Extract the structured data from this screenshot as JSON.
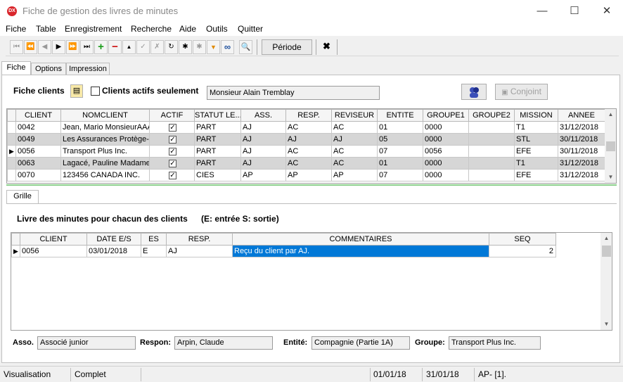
{
  "window": {
    "app_icon": "DX",
    "title": "Fiche de gestion des livres de minutes",
    "minimize": "—",
    "maximize": "☐",
    "close": "✕"
  },
  "menu": [
    "Fiche",
    "Table",
    "Enregistrement",
    "Recherche",
    "Aide",
    "Outils",
    "Quitter"
  ],
  "toolbar": {
    "buttons": [
      {
        "icon": "first-record-icon",
        "glyph": "⏮"
      },
      {
        "icon": "prev-page-icon",
        "glyph": "⏪"
      },
      {
        "icon": "prev-record-icon",
        "glyph": "◀"
      },
      {
        "icon": "next-record-icon",
        "glyph": "▶"
      },
      {
        "icon": "next-page-icon",
        "glyph": "⏩"
      },
      {
        "icon": "last-record-icon",
        "glyph": "⏭"
      },
      {
        "icon": "add-icon",
        "glyph": "+"
      },
      {
        "icon": "delete-icon",
        "glyph": "−"
      },
      {
        "icon": "edit-icon",
        "glyph": "▲"
      },
      {
        "icon": "confirm-icon",
        "glyph": "✓"
      },
      {
        "icon": "cancel-icon",
        "glyph": "✗"
      },
      {
        "icon": "refresh-icon",
        "glyph": "↻"
      },
      {
        "icon": "asterisk-icon",
        "glyph": "✱"
      },
      {
        "icon": "asterisk-grey-icon",
        "glyph": "✱"
      },
      {
        "icon": "filter-icon",
        "glyph": "▼"
      },
      {
        "icon": "binoculars-icon",
        "glyph": "∞"
      },
      {
        "icon": "search-icon",
        "glyph": "🔍"
      }
    ],
    "periode_label": "Période",
    "exit_glyph": "✖"
  },
  "tabs_top": [
    "Fiche",
    "Options",
    "Impression"
  ],
  "fiche": {
    "label": "Fiche clients",
    "actifs_label": "Clients actifs seulement",
    "actifs_checked": false,
    "client_display": "Monsieur Alain Tremblay",
    "conjoint_label": "Conjoint",
    "users_icon": "users-icon",
    "document_icon": "document-icon"
  },
  "clients_table": {
    "columns": [
      "CLIENT",
      "NOMCLIENT",
      "ACTIF",
      "STATUT LE...",
      "ASS.",
      "RESP.",
      "REVISEUR",
      "ENTITE",
      "GROUPE1",
      "GROUPE2",
      "MISSION",
      "ANNEE"
    ],
    "rows": [
      {
        "client": "0042",
        "nom": "Jean, Mario MonsieurAAA",
        "actif": true,
        "statut": "PART",
        "ass": "AJ",
        "resp": "AC",
        "reviseur": "AC",
        "entite": "01",
        "groupe1": "0000",
        "groupe2": "",
        "mission": "T1",
        "annee": "31/12/2018"
      },
      {
        "client": "0049",
        "nom": "Les Assurances Protège-T",
        "actif": true,
        "statut": "PART",
        "ass": "AJ",
        "resp": "AJ",
        "reviseur": "AJ",
        "entite": "05",
        "groupe1": "0000",
        "groupe2": "",
        "mission": "STL",
        "annee": "30/11/2018"
      },
      {
        "client": "0056",
        "nom": "Transport Plus Inc.",
        "actif": true,
        "statut": "PART",
        "ass": "AJ",
        "resp": "AC",
        "reviseur": "AC",
        "entite": "07",
        "groupe1": "0056",
        "groupe2": "",
        "mission": "EFE",
        "annee": "30/11/2018"
      },
      {
        "client": "0063",
        "nom": "Lagacé, Pauline Madame",
        "actif": true,
        "statut": "PART",
        "ass": "AJ",
        "resp": "AC",
        "reviseur": "AC",
        "entite": "01",
        "groupe1": "0000",
        "groupe2": "",
        "mission": "T1",
        "annee": "31/12/2018"
      },
      {
        "client": "0070",
        "nom": "123456 CANADA INC.",
        "actif": true,
        "statut": "CIES",
        "ass": "AP",
        "resp": "AP",
        "reviseur": "AP",
        "entite": "07",
        "groupe1": "0000",
        "groupe2": "",
        "mission": "EFE",
        "annee": "31/12/2018"
      }
    ],
    "current_row": 2
  },
  "grille": {
    "tab_label": "Grille",
    "heading": "Livre des minutes pour chacun des clients",
    "legend": "(E: entrée  S: sortie)",
    "columns": [
      "CLIENT",
      "DATE E/S",
      "ES",
      "RESP.",
      "COMMENTAIRES",
      "SEQ"
    ],
    "rows": [
      {
        "client": "0056",
        "date": "03/01/2018",
        "es": "E",
        "resp": "AJ",
        "commentaires": "Reçu du client par AJ.",
        "seq": "2"
      }
    ]
  },
  "details": {
    "asso_label": "Asso.",
    "asso_value": "Associé junior",
    "respon_label": "Respon:",
    "respon_value": "Arpin, Claude",
    "entite_label": "Entité:",
    "entite_value": "Compagnie (Partie 1A)",
    "groupe_label": "Groupe:",
    "groupe_value": "Transport Plus Inc."
  },
  "status": {
    "mode": "Visualisation",
    "state": "Complet",
    "date_from": "01/01/18",
    "date_to": "31/01/18",
    "user": "AP- [1]."
  },
  "colors": {
    "selection": "#0078d7",
    "alt_row": "#d6d6d6",
    "add_green": "#1a9c1a",
    "delete_red": "#cc1010"
  }
}
